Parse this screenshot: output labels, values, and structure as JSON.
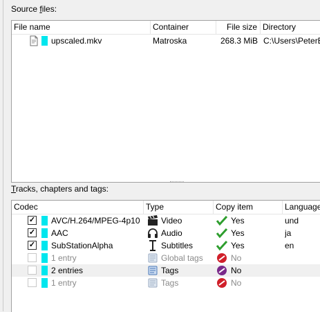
{
  "source": {
    "label_prefix": "Source ",
    "label_accel": "f",
    "label_suffix": "iles:",
    "columns": [
      "File name",
      "Container",
      "File size",
      "Directory"
    ],
    "files": [
      {
        "name": "upscaled.mkv",
        "container": "Matroska",
        "size": "268.3 MiB",
        "directory": "C:\\Users\\PeterE"
      }
    ]
  },
  "tracks": {
    "label_accel": "T",
    "label_rest": "racks, chapters and tags:",
    "columns": [
      "Codec",
      "Type",
      "Copy item",
      "Language"
    ],
    "rows": [
      {
        "codec": "AVC/H.264/MPEG-4p10",
        "type": "Video",
        "type_icon": "clapperboard-icon",
        "copy": "Yes",
        "copy_icon": "green-check-icon",
        "language": "und",
        "checked": true,
        "dim": false,
        "selected": false
      },
      {
        "codec": "AAC",
        "type": "Audio",
        "type_icon": "headphones-icon",
        "copy": "Yes",
        "copy_icon": "green-check-icon",
        "language": "ja",
        "checked": true,
        "dim": false,
        "selected": false
      },
      {
        "codec": "SubStationAlpha",
        "type": "Subtitles",
        "type_icon": "text-cursor-icon",
        "copy": "Yes",
        "copy_icon": "green-check-icon",
        "language": "en",
        "checked": true,
        "dim": false,
        "selected": false
      },
      {
        "codec": "1 entry",
        "type": "Global tags",
        "type_icon": "global-tags-icon",
        "copy": "No",
        "copy_icon": "red-no-icon",
        "language": "",
        "checked": false,
        "dim": true,
        "selected": false
      },
      {
        "codec": "2 entries",
        "type": "Tags",
        "type_icon": "tags-icon",
        "copy": "No",
        "copy_icon": "purple-no-icon",
        "language": "",
        "checked": false,
        "dim": false,
        "selected": true
      },
      {
        "codec": "1 entry",
        "type": "Tags",
        "type_icon": "tags-icon",
        "copy": "No",
        "copy_icon": "red-no-icon",
        "language": "",
        "checked": false,
        "dim": true,
        "selected": false
      }
    ]
  },
  "colors": {
    "track_color": "#00e6ee",
    "yes_green": "#2e9e2e",
    "no_red": "#d0202a",
    "no_purple": "#7a2a8a"
  }
}
